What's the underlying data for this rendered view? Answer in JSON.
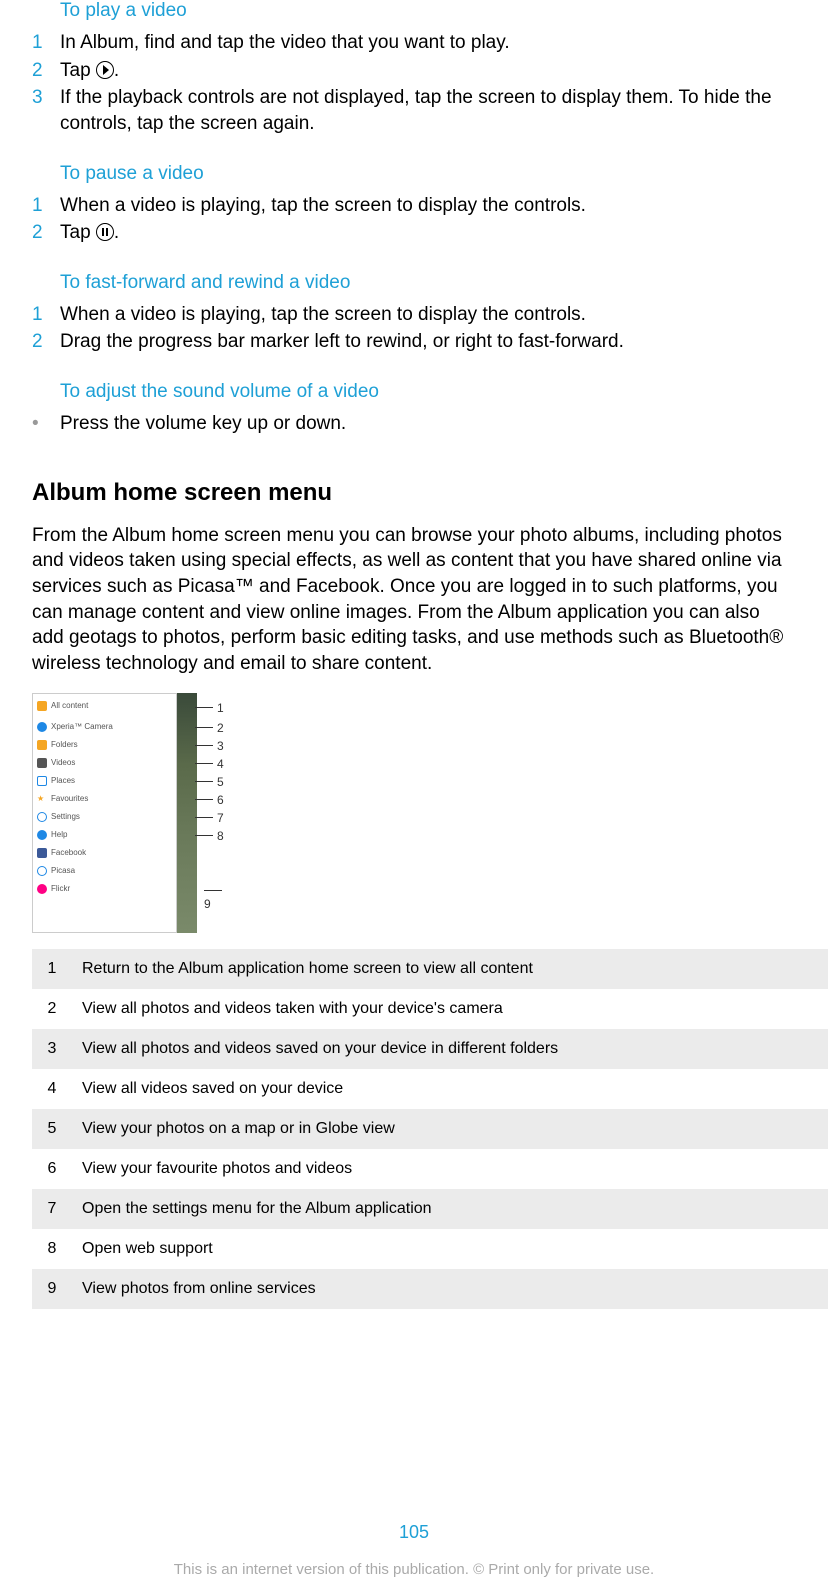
{
  "section_play": {
    "title": "To play a video",
    "steps": [
      "In Album, find and tap the video that you want to play.",
      "Tap ",
      "If the playback controls are not displayed, tap the screen to display them. To hide the controls, tap the screen again."
    ],
    "tap_suffix": "."
  },
  "section_pause": {
    "title": "To pause a video",
    "steps": [
      "When a video is playing, tap the screen to display the controls.",
      "Tap "
    ],
    "tap_suffix": "."
  },
  "section_ff": {
    "title": "To fast-forward and rewind a video",
    "steps": [
      "When a video is playing, tap the screen to display the controls.",
      "Drag the progress bar marker left to rewind, or right to fast-forward."
    ]
  },
  "section_vol": {
    "title": "To adjust the sound volume of a video",
    "bullet": "Press the volume key up or down."
  },
  "main_section": {
    "title": "Album home screen menu",
    "body": "From the Album home screen menu you can browse your photo albums, including photos and videos taken using special effects, as well as content that you have shared online via services such as Picasa™ and Facebook. Once you are logged in to such platforms, you can manage content and view online images. From the Album application you can also add geotags to photos, perform basic editing tasks, and use methods such as Bluetooth® wireless technology and email to share content."
  },
  "diagram_labels": {
    "rows": [
      {
        "text": "All content",
        "color": "#f5a623"
      },
      {
        "text": "Xperia™ Camera",
        "color": "#1e88e5"
      },
      {
        "text": "Folders",
        "color": "#f5a623"
      },
      {
        "text": "Videos",
        "color": "#555"
      },
      {
        "text": "Places",
        "color": "#1e88e5"
      },
      {
        "text": "Favourites",
        "color": "#f5a623"
      },
      {
        "text": "Settings",
        "color": "#1e88e5"
      },
      {
        "text": "Help",
        "color": "#1e88e5"
      },
      {
        "text": "Facebook",
        "color": "#3b5998"
      },
      {
        "text": "Picasa",
        "color": "#1e88e5"
      },
      {
        "text": "Flickr",
        "color": "#ff0084"
      }
    ],
    "callouts": [
      "1",
      "2",
      "3",
      "4",
      "5",
      "6",
      "7",
      "8",
      "9"
    ]
  },
  "legend": [
    {
      "n": "1",
      "text": "Return to the Album application home screen to view all content"
    },
    {
      "n": "2",
      "text": "View all photos and videos taken with your device's camera"
    },
    {
      "n": "3",
      "text": "View all photos and videos saved on your device in different folders"
    },
    {
      "n": "4",
      "text": "View all videos saved on your device"
    },
    {
      "n": "5",
      "text": "View your photos on a map or in Globe view"
    },
    {
      "n": "6",
      "text": "View your favourite photos and videos"
    },
    {
      "n": "7",
      "text": "Open the settings menu for the Album application"
    },
    {
      "n": "8",
      "text": "Open web support"
    },
    {
      "n": "9",
      "text": "View photos from online services"
    }
  ],
  "footer": {
    "page": "105",
    "note": "This is an internet version of this publication. © Print only for private use."
  }
}
